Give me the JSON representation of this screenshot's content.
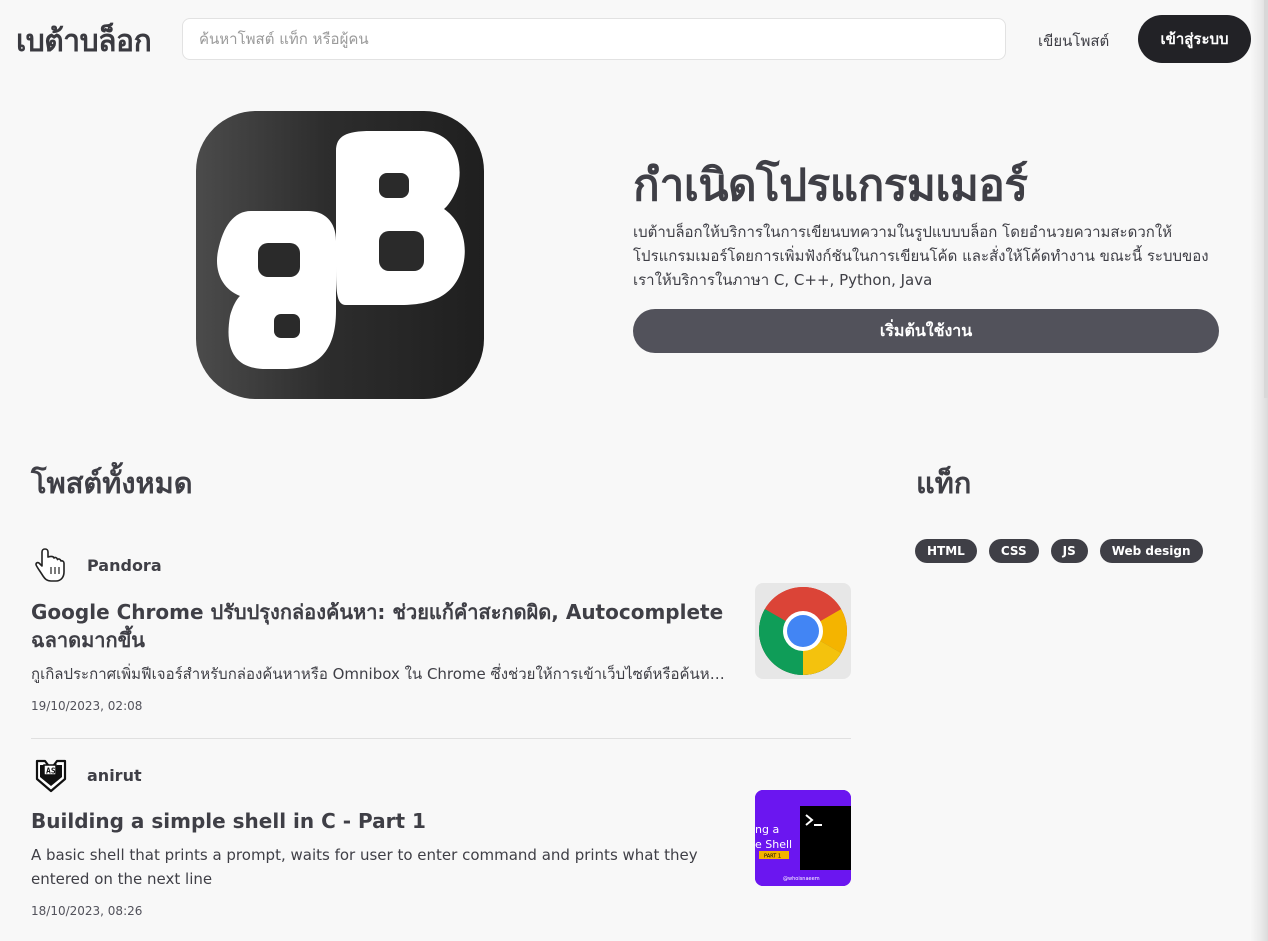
{
  "nav": {
    "brand": "เบต้าบล็อก",
    "search_placeholder": "ค้นหาโพสต์ แท็ก หรือผู้คน",
    "write_link": "เขียนโพสต์",
    "login_button": "เข้าสู่ระบบ"
  },
  "hero": {
    "logo": "bb-logo",
    "title": "กำเนิดโปรแกรมเมอร์",
    "description": "เบต้าบล็อกให้บริการในการเขียนบทความในรูปแบบบล็อก โดยอำนวยความสะดวกให้โปรแกรมเมอร์โดยการเพิ่มฟังก์ชันในการเขียนโค้ด และสั่งให้โค้ดทำงาน ขณะนี้ ระบบของเราให้บริการในภาษา C, C++, Python, Java",
    "start_button": "เริ่มต้นใช้งาน"
  },
  "posts_section": {
    "title": "โพสต์ทั้งหมด",
    "posts": [
      {
        "author": "Pandora",
        "avatar_icon": "hand-pointer-icon",
        "title": "Google Chrome ปรับปรุงกล่องค้นหา: ช่วยแก้คำสะกดผิด, Autocomplete ฉลาดมากขึ้น",
        "excerpt": "กูเกิลประกาศเพิ่มฟีเจอร์สำหรับกล่องค้นหาหรือ Omnibox ใน Chrome ซึ่งช่วยให้การเข้าเว็บไซต์หรือค้นหาข้อมูลทำได้ง่ายและรวดเร็วขึ้น",
        "date": "19/10/2023, 02:08",
        "thumbnail_icon": "chrome-logo-icon"
      },
      {
        "author": "anirut",
        "avatar_icon": "shield-logo-icon",
        "title": "Building a simple shell in C - Part 1",
        "excerpt": "A basic shell that prints a prompt, waits for user to enter command and prints what they entered on the next line",
        "date": "18/10/2023, 08:26",
        "thumbnail_icon": "terminal-icon",
        "thumbnail_text": [
          "ng a",
          "e Shell",
          "PART 1",
          "@whoisnaeem"
        ]
      }
    ]
  },
  "tags_section": {
    "title": "แท็ก",
    "tags": [
      "HTML",
      "CSS",
      "JS",
      "Web design"
    ]
  },
  "colors": {
    "background": "#f8f8f8",
    "text": "#3f3f46",
    "dark_button": "#222226",
    "primary_button": "#52525b",
    "tag": "#3f3f46",
    "terminal_thumb": "#6b16f0"
  }
}
